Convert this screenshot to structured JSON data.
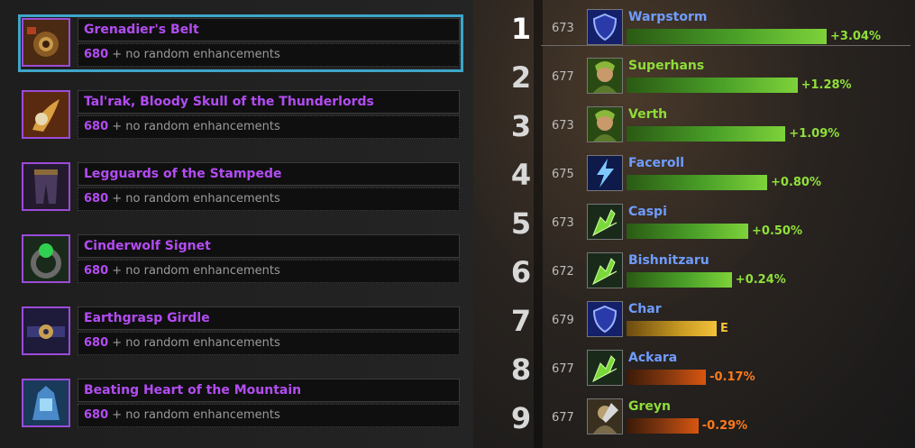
{
  "items": [
    {
      "name": "Grenadier's Belt",
      "ilvl": "680",
      "enhancements": "+ no random enhancements",
      "icon": "belt-icon",
      "selected": true
    },
    {
      "name": "Tal'rak, Bloody Skull of the Thunderlords",
      "ilvl": "680",
      "enhancements": "+ no random enhancements",
      "icon": "skull-trinket-icon",
      "selected": false
    },
    {
      "name": "Legguards of the Stampede",
      "ilvl": "680",
      "enhancements": "+ no random enhancements",
      "icon": "legguards-icon",
      "selected": false
    },
    {
      "name": "Cinderwolf Signet",
      "ilvl": "680",
      "enhancements": "+ no random enhancements",
      "icon": "ring-icon",
      "selected": false
    },
    {
      "name": "Earthgrasp Girdle",
      "ilvl": "680",
      "enhancements": "+ no random enhancements",
      "icon": "girdle-icon",
      "selected": false
    },
    {
      "name": "Beating Heart of the Mountain",
      "ilvl": "680",
      "enhancements": "+ no random enhancements",
      "icon": "heart-trinket-icon",
      "selected": false
    }
  ],
  "rankings": [
    {
      "rank": "1",
      "ilvl": "673",
      "name": "Warpstorm",
      "label": "+3.04%",
      "value": 3.04,
      "icon": "shield-icon",
      "name_color": "#6f9cff",
      "bar_color": "green"
    },
    {
      "rank": "2",
      "ilvl": "677",
      "name": "Superhans",
      "label": "+1.28%",
      "value": 1.28,
      "icon": "hunter-portrait-icon",
      "name_color": "#8fdc3a",
      "bar_color": "green"
    },
    {
      "rank": "3",
      "ilvl": "673",
      "name": "Verth",
      "label": "+1.09%",
      "value": 1.09,
      "icon": "hunter-portrait-icon",
      "name_color": "#8fdc3a",
      "bar_color": "green"
    },
    {
      "rank": "4",
      "ilvl": "675",
      "name": "Faceroll",
      "label": "+0.80%",
      "value": 0.8,
      "icon": "lightning-icon",
      "name_color": "#6f9cff",
      "bar_color": "green"
    },
    {
      "rank": "5",
      "ilvl": "673",
      "name": "Caspi",
      "label": "+0.50%",
      "value": 0.5,
      "icon": "claw-icon",
      "name_color": "#6f9cff",
      "bar_color": "green"
    },
    {
      "rank": "6",
      "ilvl": "672",
      "name": "Bishnitzaru",
      "label": "+0.24%",
      "value": 0.24,
      "icon": "claw-icon",
      "name_color": "#6f9cff",
      "bar_color": "green"
    },
    {
      "rank": "7",
      "ilvl": "679",
      "name": "Char",
      "label": "E",
      "value": 0.0,
      "icon": "shield-icon",
      "name_color": "#6f9cff",
      "bar_color": "gold"
    },
    {
      "rank": "8",
      "ilvl": "677",
      "name": "Ackara",
      "label": "-0.17%",
      "value": -0.17,
      "icon": "claw-icon",
      "name_color": "#6f9cff",
      "bar_color": "orange"
    },
    {
      "rank": "9",
      "ilvl": "677",
      "name": "Greyn",
      "label": "-0.29%",
      "value": -0.29,
      "icon": "warrior-icon",
      "name_color": "#8fdc3a",
      "bar_color": "orange"
    }
  ],
  "colors": {
    "item_epic": "#b34cf2",
    "selected_outline": "#3ea6c9",
    "green_label": "#8fe03a",
    "orange_label": "#ff7a1a",
    "gold_label": "#f2c23a"
  }
}
